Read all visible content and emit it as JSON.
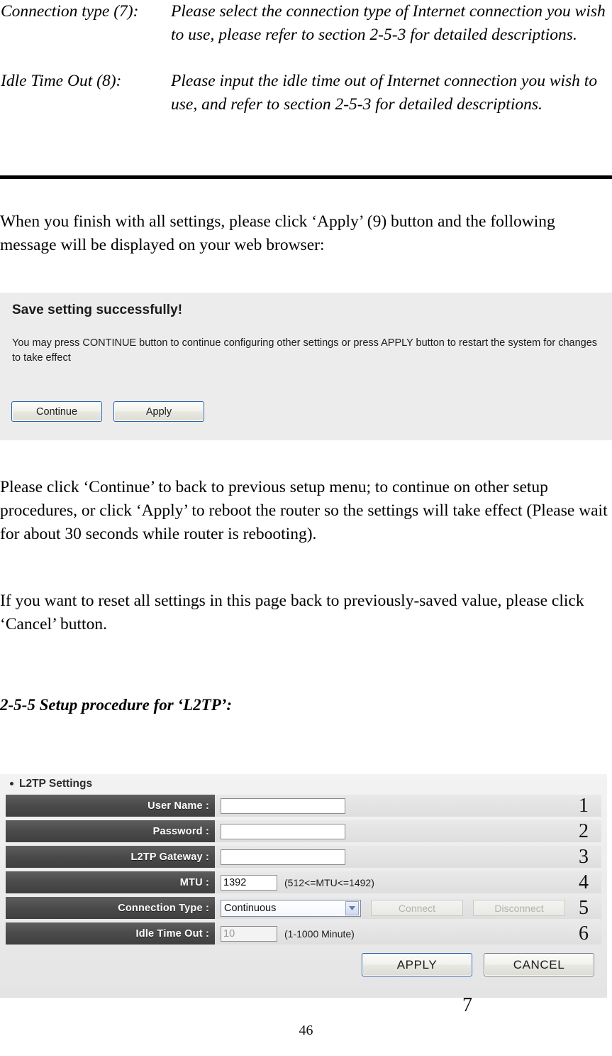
{
  "definitions": [
    {
      "term": "Connection type (7):",
      "description": "Please select the connection type of Internet connection you wish to use, please refer to section 2-5-3 for detailed descriptions."
    },
    {
      "term": "Idle Time Out (8):",
      "description": "Please input the idle time out of Internet connection you wish to use, and refer to section 2-5-3 for detailed descriptions."
    }
  ],
  "paragraphs": {
    "intro": "When you finish with all settings, please click ‘Apply’ (9) button and the following message will be displayed on your web browser:",
    "continue_note": "Please click ‘Continue’ to back to previous setup menu; to continue on other setup procedures, or click ‘Apply’ to reboot the router so the settings will take effect (Please wait for about 30 seconds while router is rebooting).",
    "reset_note": "If you want to reset all settings in this page back to previously-saved value, please click ‘Cancel’ button."
  },
  "section_heading": "2-5-5 Setup procedure for ‘L2TP’:",
  "dialog": {
    "title": "Save setting successfully!",
    "body": "You may press CONTINUE button to continue configuring other settings or press APPLY button to restart the system for changes to take effect",
    "buttons": {
      "continue": "Continue",
      "apply": "Apply"
    }
  },
  "l2tp": {
    "panel_title": "L2TP Settings",
    "rows": [
      {
        "label": "User Name :",
        "value": "",
        "placeholder": "",
        "hint": "",
        "callout": "1"
      },
      {
        "label": "Password :",
        "value": "",
        "placeholder": "",
        "hint": "",
        "callout": "2"
      },
      {
        "label": "L2TP Gateway :",
        "value": "",
        "placeholder": "",
        "hint": "",
        "callout": "3"
      },
      {
        "label": "MTU :",
        "value": "1392",
        "placeholder": "",
        "hint": "(512<=MTU<=1492)",
        "callout": "4"
      },
      {
        "label": "Connection Type :",
        "value": "Continuous",
        "placeholder": "",
        "hint": "",
        "callout": "5"
      },
      {
        "label": "Idle Time Out :",
        "value": "10",
        "placeholder": "",
        "hint": "(1-1000 Minute)",
        "callout": "6"
      }
    ],
    "connect_button": "Connect",
    "disconnect_button": "Disconnect",
    "apply_button": "APPLY",
    "cancel_button": "CANCEL",
    "actions_callout": "7"
  },
  "page_number": "46",
  "colors": {
    "label_dark": "#4a4a4a",
    "panel_bg": "#ececec",
    "accent_blue": "#2a63a8"
  }
}
